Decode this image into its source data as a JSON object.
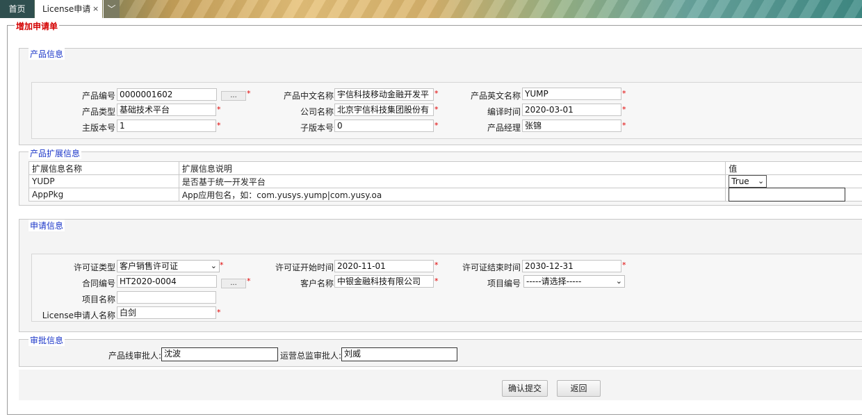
{
  "tabs": {
    "home": "首页",
    "license": "License申请",
    "close_glyph": "×",
    "more_glyph": "﹀"
  },
  "panel": {
    "title": "增加申请单"
  },
  "product_info": {
    "legend": "产品信息",
    "product_no": {
      "label": "产品编号",
      "value": "0000001602",
      "button": "..."
    },
    "product_cn_name": {
      "label": "产品中文名称",
      "value": "宇信科技移动金融开发平"
    },
    "product_en_name": {
      "label": "产品英文名称",
      "value": "YUMP"
    },
    "product_type": {
      "label": "产品类型",
      "value": "基础技术平台"
    },
    "company_name": {
      "label": "公司名称",
      "value": "北京宇信科技集团股份有"
    },
    "build_time": {
      "label": "编译时间",
      "value": "2020-03-01"
    },
    "major_version": {
      "label": "主版本号",
      "value": "1"
    },
    "minor_version": {
      "label": "子版本号",
      "value": "0"
    },
    "product_manager": {
      "label": "产品经理",
      "value": "张锦"
    }
  },
  "ext_info": {
    "legend": "产品扩展信息",
    "headers": [
      "扩展信息名称",
      "扩展信息说明",
      "值"
    ],
    "rows": [
      {
        "name": "YUDP",
        "desc": "是否基于统一开发平台",
        "value": "True"
      },
      {
        "name": "AppPkg",
        "desc": "App应用包名，如：com.yusys.yump|com.yusy.oa",
        "value": ""
      }
    ]
  },
  "apply_info": {
    "legend": "申请信息",
    "license_type": {
      "label": "许可证类型",
      "value": "客户销售许可证"
    },
    "start_time": {
      "label": "许可证开始时间",
      "value": "2020-11-01"
    },
    "end_time": {
      "label": "许可证结束时间",
      "value": "2030-12-31"
    },
    "contract_no": {
      "label": "合同编号",
      "value": "HT2020-0004",
      "button": "..."
    },
    "customer_name": {
      "label": "客户名称",
      "value": "中银金融科技有限公司"
    },
    "project_no": {
      "label": "项目编号",
      "value": "-----请选择-----"
    },
    "project_name": {
      "label": "项目名称",
      "value": ""
    },
    "applicant": {
      "label": "License申请人名称",
      "value": "白剑"
    }
  },
  "approval_info": {
    "legend": "审批信息",
    "line_approver": {
      "label": "产品线审批人:",
      "value": "沈波"
    },
    "ops_approver": {
      "label": "运营总监审批人:",
      "value": "刘威"
    }
  },
  "actions": {
    "confirm": "确认提交",
    "back": "返回"
  },
  "required_mark": "*",
  "dropdown_glyph": "⌄",
  "colors": {
    "required": "#e00000",
    "legend": "#1a35c8",
    "title": "#d40000",
    "home_tab": "#2f4f4f"
  }
}
